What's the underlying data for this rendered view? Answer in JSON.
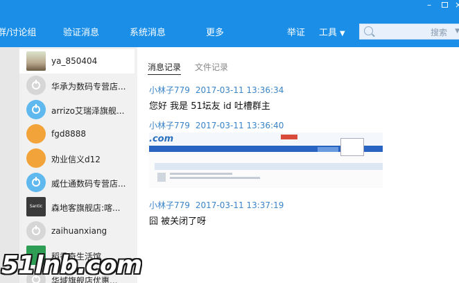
{
  "window": {
    "minimize": "–",
    "maximize": "",
    "close": "×"
  },
  "nav": [
    "群/讨论组",
    "验证消息",
    "系统消息",
    "更多",
    "举证",
    "工具"
  ],
  "search": {
    "placeholder": "搜索"
  },
  "contacts": [
    {
      "name": "ya_850404",
      "avatar": "photo"
    },
    {
      "name": "华承为数码专营店...",
      "avatar": "grey"
    },
    {
      "name": "arrizo艾瑞泽旗舰...",
      "avatar": "blue"
    },
    {
      "name": "fgd8888",
      "avatar": "fox"
    },
    {
      "name": "劝业信义d12",
      "avatar": "fox"
    },
    {
      "name": "威仕通数码专营店...",
      "avatar": "blue"
    },
    {
      "name": "森地客旗舰店:喀...",
      "avatar": "santic"
    },
    {
      "name": "zaihuanxiang",
      "avatar": "grey"
    },
    {
      "name": "稻香奇生活馆",
      "avatar": "green"
    },
    {
      "name": "华域旗舰店优惠...",
      "avatar": "grey"
    }
  ],
  "tabs": [
    "消息记录",
    "文件记录"
  ],
  "messages": [
    {
      "sender": "小林子779",
      "time": "2017-03-11 13:36:34",
      "text": "您好  我是 51坛友    id 吐槽群主"
    },
    {
      "sender": "小林子779",
      "time": "2017-03-11 13:36:40",
      "text": ""
    },
    {
      "sender": "小林子779",
      "time": "2017-03-11 13:37:19",
      "text": "囧 被关闭了呀"
    }
  ],
  "image_logo": ".com",
  "watermark": "51lnb.com",
  "colors": {
    "accent": "#1b8fe8",
    "link": "#3a84c8"
  }
}
